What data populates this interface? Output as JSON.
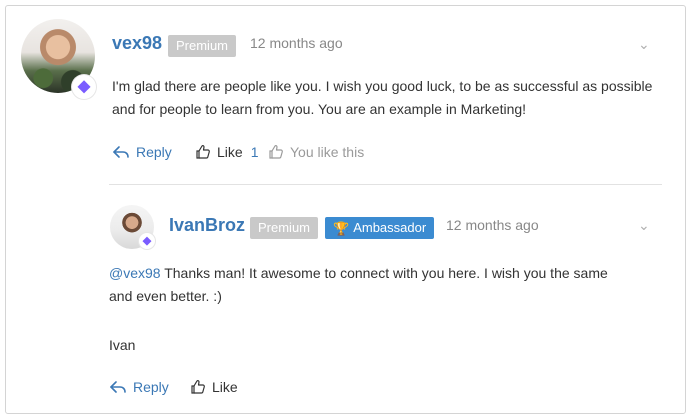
{
  "comments": [
    {
      "username": "vex98",
      "badges": [
        "Premium"
      ],
      "time": "12 months ago",
      "text": "I'm glad there are people like you. I wish you good luck, to be as successful as possible and for people to learn from you. You are an example in Marketing!",
      "actions": {
        "reply_label": "Reply",
        "like_label": "Like",
        "like_count": "1",
        "you_like_label": "You like this"
      }
    },
    {
      "username": "IvanBroz",
      "badges": [
        "Premium",
        "Ambassador"
      ],
      "time": "12 months ago",
      "mention": "@vex98",
      "text_line1": " Thanks man! It awesome to connect with you here. I wish you the same",
      "text_line2": "and even better. :)",
      "signature": "Ivan",
      "actions": {
        "reply_label": "Reply",
        "like_label": "Like"
      }
    }
  ],
  "icons": {
    "gem": "diamond-icon",
    "trophy": "trophy-icon",
    "chevron": "chevron-down-icon",
    "reply": "reply-icon",
    "like": "thumbs-up-icon"
  },
  "colors": {
    "link": "#3b78b5",
    "premium_badge": "#c9c9c9",
    "ambassador_badge": "#3b8bd1",
    "gem": "#7a5cff"
  }
}
